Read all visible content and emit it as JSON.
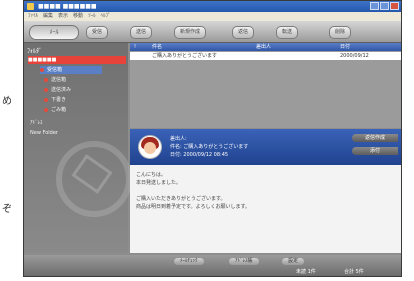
{
  "page_text": {
    "left_top_char": "め",
    "left_bottom_char": "ぞ"
  },
  "window": {
    "title": "■■■■ ■■■■■■"
  },
  "menubar": [
    "ﾌｧｲﾙ",
    "編集",
    "表示",
    "移動",
    "ﾂｰﾙ",
    "ﾍﾙﾌﾟ"
  ],
  "toolbar": {
    "logo": "ﾒｰﾙ",
    "buttons": [
      "受信",
      "送信",
      "新規作成",
      "返信",
      "転送",
      "削除"
    ]
  },
  "sidebar": {
    "header": "ﾌｫﾙﾀﾞ",
    "account": "■■■■■■",
    "items": [
      "受信箱",
      "送信箱",
      "送信済み",
      "下書き",
      "ごみ箱"
    ],
    "extra": [
      "ｱﾄﾞﾚｽ",
      "New Folder"
    ]
  },
  "list": {
    "columns": [
      "!",
      "件名",
      "差出人",
      "日付"
    ],
    "rows": [
      [
        "",
        "ご購入ありがとうございます",
        "",
        "2000/09/12"
      ]
    ]
  },
  "detail": {
    "from": "差出人:",
    "subject": "件名: ご購入ありがとうございます",
    "date": "日付: 2000/09/12 08:45",
    "buttons": [
      "返信作成",
      "添付"
    ],
    "lines": [
      "こんにちは。",
      "本日発送しました。",
      "",
      "ご購入いただきありがとうございます。",
      "商品は明日到着予定です。よろしくお願いします。"
    ]
  },
  "statusbar": {
    "buttons": [
      "ﾒｰﾙﾁｪｯｸ",
      "ｱﾄﾞﾚｽ帳",
      "設定"
    ],
    "left": "",
    "right": [
      "未読 1件",
      "合計 5件"
    ]
  },
  "colors": {
    "accent_red": "#e8433a",
    "header_blue": "#2f56a6",
    "body_gray": "#8d8d8d"
  }
}
